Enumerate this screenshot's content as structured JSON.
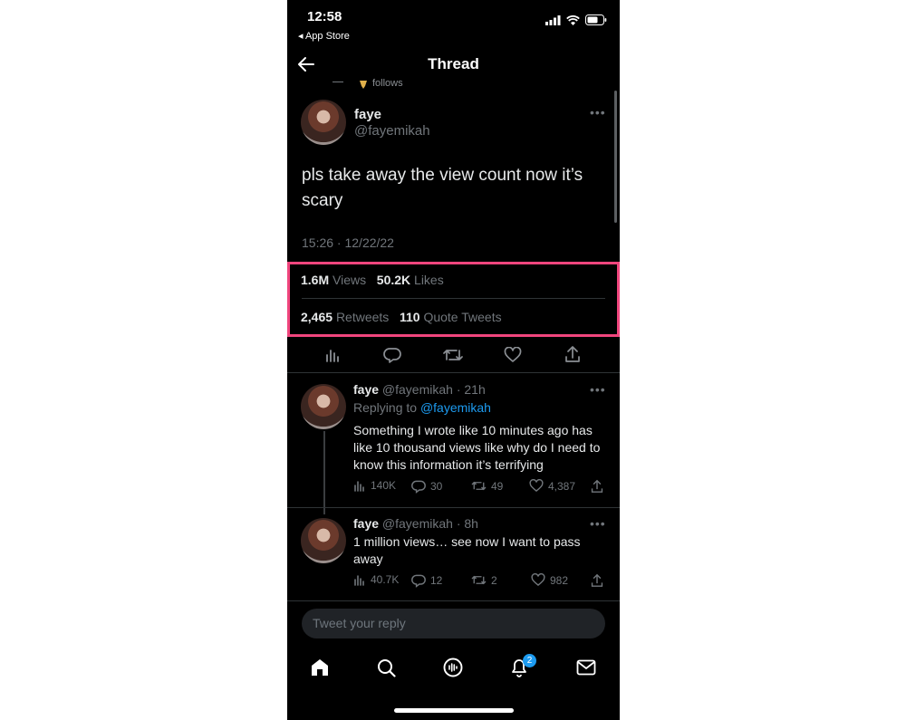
{
  "status_bar": {
    "time": "12:58",
    "back_label": "◂ App Store"
  },
  "header": {
    "title": "Thread"
  },
  "context": {
    "follows_text": "follows"
  },
  "main_tweet": {
    "name": "faye",
    "handle": "@fayemikah",
    "text": "pls take away the view count now it’s scary",
    "timestamp": "15:26 · 12/22/22",
    "stats": {
      "views_value": "1.6M",
      "views_label": "Views",
      "likes_value": "50.2K",
      "likes_label": "Likes",
      "retweets_value": "2,465",
      "retweets_label": "Retweets",
      "quotes_value": "110",
      "quotes_label": "Quote Tweets"
    }
  },
  "replies": [
    {
      "name": "faye",
      "handle_time": "@fayemikah · 21h",
      "replying_prefix": "Replying to",
      "replying_handle": "@fayemikah",
      "text": "Something I wrote like 10 minutes ago has like 10 thousand views like why do I need to know this information it’s terrifying",
      "views": "140K",
      "comments": "30",
      "retweets": "49",
      "likes": "4,387"
    },
    {
      "name": "faye",
      "handle_time": "@fayemikah · 8h",
      "text": "1 million views… see now I want to pass away",
      "views": "40.7K",
      "comments": "12",
      "retweets": "2",
      "likes": "982"
    }
  ],
  "composer": {
    "placeholder": "Tweet your reply"
  },
  "tab_bar": {
    "notifications_badge": "2"
  },
  "colors": {
    "accent": "#1d9bf0",
    "highlight": "#f0457d",
    "background": "#000000"
  }
}
